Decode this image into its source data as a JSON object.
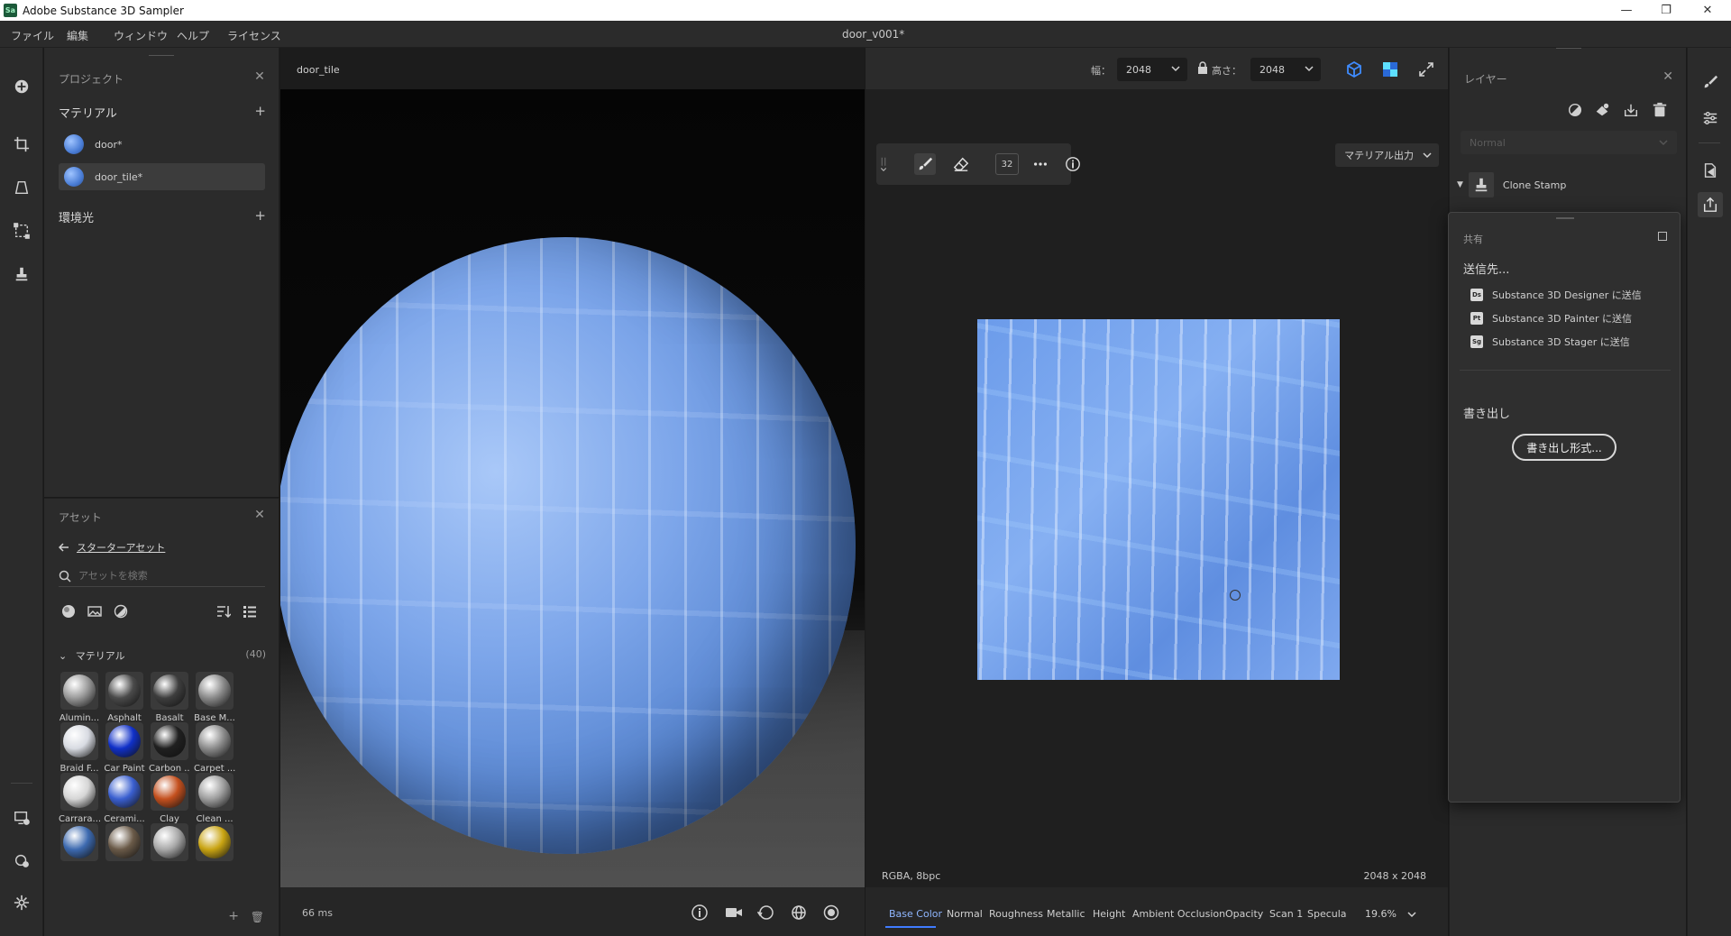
{
  "window": {
    "app_icon": "Sa",
    "title": "Adobe Substance 3D Sampler",
    "minimize": "—",
    "restore": "❐",
    "close": "✕"
  },
  "menubar": {
    "items": [
      "ファイル",
      "編集",
      "ウィンドウ",
      "ヘルプ",
      "ライセンス"
    ],
    "document_title": "door_v001*"
  },
  "project_panel": {
    "title": "プロジェクト",
    "close": "✕",
    "materials_label": "マテリアル",
    "add": "+",
    "materials": [
      {
        "name": "door*",
        "selected": false
      },
      {
        "name": "door_tile*",
        "selected": true
      }
    ],
    "environment_label": "環境光"
  },
  "assets_panel": {
    "title": "アセット",
    "close": "✕",
    "back_link": "スターターアセット",
    "search_placeholder": "アセットを検索",
    "group_label": "マテリアル",
    "group_count": "(40)",
    "materials": [
      {
        "label": "Alumin...",
        "color": "#9a9a9a"
      },
      {
        "label": "Asphalt",
        "color": "#4a4a4a"
      },
      {
        "label": "Basalt",
        "color": "#3e3e3e"
      },
      {
        "label": "Base M...",
        "color": "#8a8a8a"
      },
      {
        "label": "Braid F...",
        "color": "#d8dbe2"
      },
      {
        "label": "Car Paint",
        "color": "#1030c8"
      },
      {
        "label": "Carbon ...",
        "color": "#202020"
      },
      {
        "label": "Carpet ...",
        "color": "#8c8c8c"
      },
      {
        "label": "Carrara...",
        "color": "#d6d6d6"
      },
      {
        "label": "Cerami...",
        "color": "#3a5fd0"
      },
      {
        "label": "Clay",
        "color": "#c4501e"
      },
      {
        "label": "Clean ...",
        "color": "#9e9e9e"
      },
      {
        "label": "",
        "color": "#3d6ab0"
      },
      {
        "label": "",
        "color": "#6a5a48"
      },
      {
        "label": "",
        "color": "#a8a8a8"
      },
      {
        "label": "",
        "color": "#c9a412"
      }
    ],
    "add": "+",
    "delete": "🗑"
  },
  "viewport3d": {
    "tab": "door_tile",
    "render_time": "66 ms"
  },
  "viewport2d": {
    "width_label": "幅：",
    "width_value": "2048",
    "height_label": "高さ：",
    "height_value": "2048",
    "brush_size": "32",
    "material_output": "マテリアル出力",
    "format": "RGBA, 8bpc",
    "resolution": "2048 x 2048",
    "channels": [
      "Base Color",
      "Normal",
      "Roughness",
      "Metallic",
      "Height",
      "Ambient Occlusion",
      "Opacity",
      "Scan 1",
      "Specula"
    ],
    "active_channel": "Base Color",
    "zoom": "19.6%"
  },
  "layers_panel": {
    "title": "レイヤー",
    "close": "✕",
    "blend_mode": "Normal",
    "layers": [
      {
        "name": "Clone Stamp"
      }
    ]
  },
  "share_popup": {
    "title": "共有",
    "send_to_label": "送信先...",
    "send_targets": [
      {
        "app": "Ds",
        "label": "Substance 3D Designer に送信"
      },
      {
        "app": "Pt",
        "label": "Substance 3D Painter に送信"
      },
      {
        "app": "Sg",
        "label": "Substance 3D Stager に送信"
      }
    ],
    "export_label": "書き出し",
    "export_button": "書き出し形式..."
  },
  "colors": {
    "accent": "#3f7bff",
    "panel": "#2b2b2b",
    "viewport": "#1f1f1f"
  }
}
